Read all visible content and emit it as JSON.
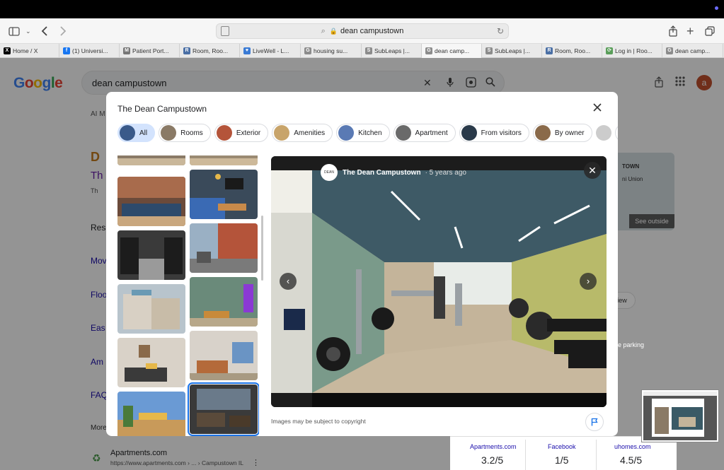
{
  "browser": {
    "address": "dean campustown",
    "tabs": [
      {
        "label": "Home / X",
        "icon": "x-logo-icon",
        "color": "#000000",
        "glyph": "X",
        "w": 84
      },
      {
        "label": "(1) Universi...",
        "icon": "facebook-icon",
        "color": "#1877f2",
        "glyph": "f",
        "w": 85
      },
      {
        "label": "Patient Port...",
        "icon": "portal-icon",
        "color": "#777777",
        "glyph": "M",
        "w": 85
      },
      {
        "label": "Room, Roo...",
        "icon": "room-icon",
        "color": "#4a6fa5",
        "glyph": "R",
        "w": 85
      },
      {
        "label": "LiveWell - L...",
        "icon": "heart-icon",
        "color": "#3a7bd5",
        "glyph": "♥",
        "w": 86
      },
      {
        "label": "housing su...",
        "icon": "google-icon",
        "color": "#8c8c8c",
        "glyph": "G",
        "w": 86
      },
      {
        "label": "SubLeaps |...",
        "icon": "subleaps-icon",
        "color": "#8c8c8c",
        "glyph": "S",
        "w": 85
      },
      {
        "label": "dean camp...",
        "icon": "google-icon",
        "color": "#8c8c8c",
        "glyph": "G",
        "w": 85,
        "active": true
      },
      {
        "label": "SubLeaps |...",
        "icon": "subleaps-icon",
        "color": "#8c8c8c",
        "glyph": "S",
        "w": 85
      },
      {
        "label": "Room, Roo...",
        "icon": "room-icon",
        "color": "#4a6fa5",
        "glyph": "R",
        "w": 85
      },
      {
        "label": "Log in | Roo...",
        "icon": "login-icon",
        "color": "#5a9e5a",
        "glyph": "⟳",
        "w": 85
      },
      {
        "label": "dean camp...",
        "icon": "google-icon",
        "color": "#8c8c8c",
        "glyph": "G",
        "w": 86
      }
    ]
  },
  "google": {
    "logo": "Google",
    "query": "dean campustown",
    "avatar_letter": "a",
    "bottom_result_title": "Apartments.com",
    "bottom_result_url": "https://www.apartments.com › ... › Campustown IL",
    "ratings": [
      {
        "source": "Apartments.com",
        "score": "3.2/5"
      },
      {
        "source": "Facebook",
        "score": "1/5"
      },
      {
        "source": "uhomes.com",
        "score": "4.5/5"
      }
    ],
    "partial_left": [
      "Th",
      "Th",
      "Res",
      "Mov",
      "Floo",
      "Eas",
      "Am",
      "FAQ",
      "More"
    ],
    "see_outside": "See outside",
    "view": "iew",
    "parking": "e parking",
    "town": "TOWN",
    "union": "ni Union"
  },
  "modal": {
    "title": "The Dean Campustown",
    "chips": [
      "All",
      "Rooms",
      "Exterior",
      "Amenities",
      "Kitchen",
      "Apartment",
      "From visitors",
      "By owner"
    ],
    "viewer": {
      "source_name": "The Dean Campustown",
      "time": "· 5 years ago",
      "copyright": "Images may be subject to copyright"
    }
  }
}
